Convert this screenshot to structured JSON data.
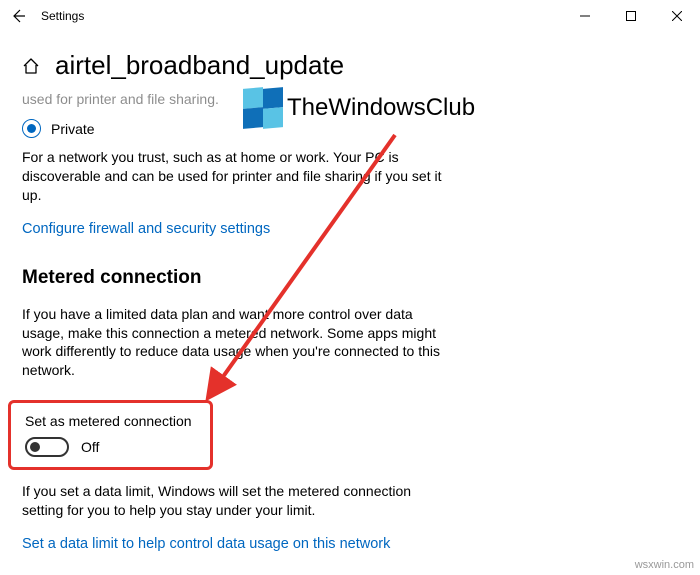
{
  "window": {
    "title": "Settings"
  },
  "header": {
    "title": "airtel_broadband_update"
  },
  "truncated_text": "used for printer and file sharing.",
  "private_radio": {
    "label": "Private",
    "description": "For a network you trust, such as at home or work. Your PC is discoverable and can be used for printer and file sharing if you set it up."
  },
  "firewall_link": "Configure firewall and security settings",
  "metered": {
    "heading": "Metered connection",
    "description": "If you have a limited data plan and want more control over data usage, make this connection a metered network. Some apps might work differently to reduce data usage when you're connected to this network.",
    "toggle_label": "Set as metered connection",
    "toggle_state": "Off",
    "note": "If you set a data limit, Windows will set the metered connection setting for you to help you stay under your limit.",
    "data_limit_link": "Set a data limit to help control data usage on this network"
  },
  "watermark": {
    "brand": "TheWindowsClub",
    "site": "wsxwin.com"
  }
}
